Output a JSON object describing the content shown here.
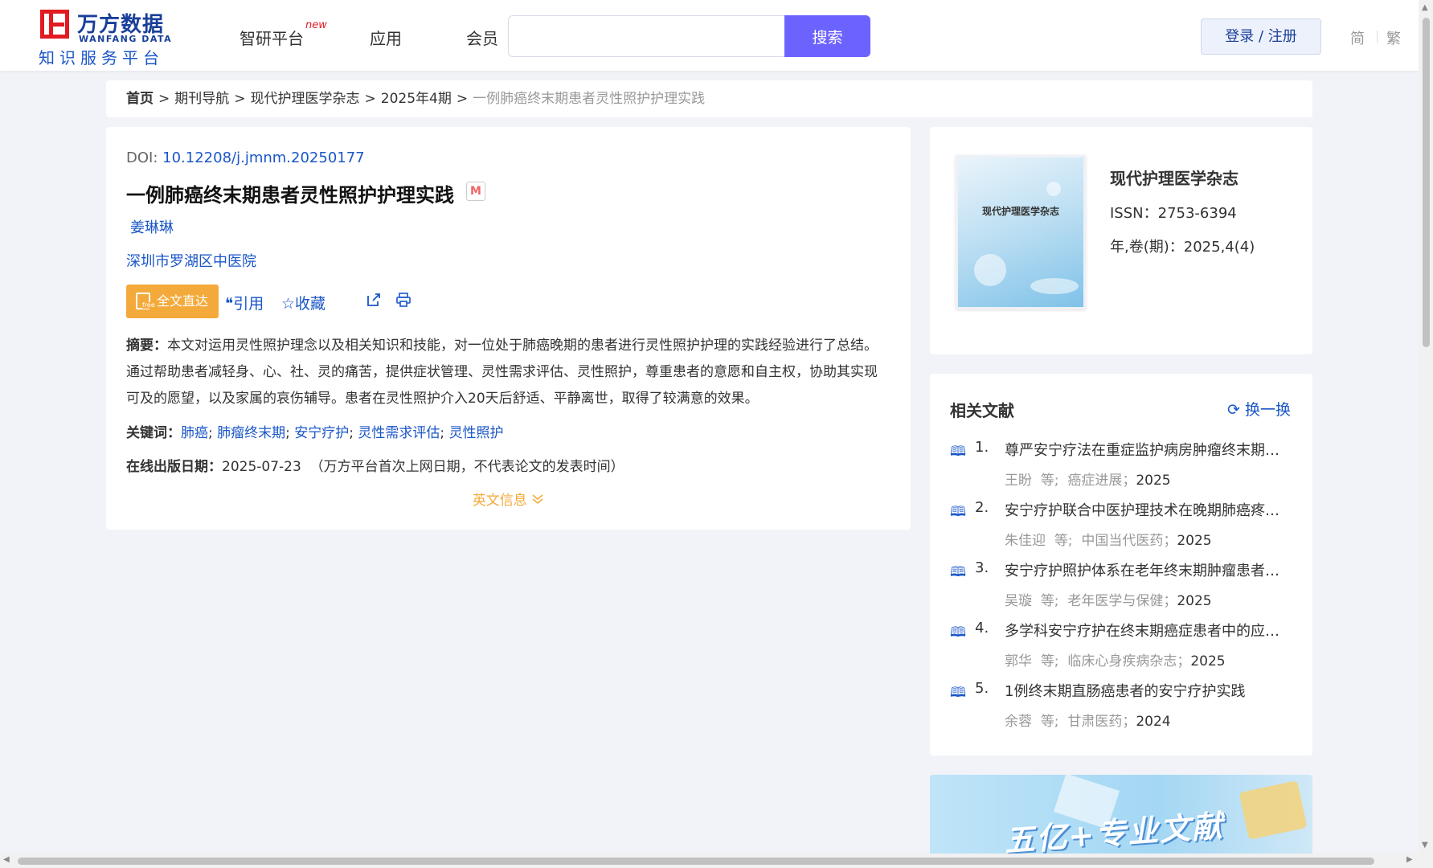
{
  "header": {
    "logo": {
      "cn": "万方数据",
      "en": "WANFANG DATA",
      "sub": "知识服务平台"
    },
    "nav": [
      {
        "label": "智研平台",
        "badge": "new"
      },
      {
        "label": "应用"
      },
      {
        "label": "会员"
      }
    ],
    "search": {
      "value": "",
      "placeholder": "",
      "button": "搜索"
    },
    "login": "登录 / 注册",
    "lang": {
      "simplified": "简",
      "traditional": "繁"
    }
  },
  "breadcrumb": {
    "items": [
      "首页",
      "期刊导航",
      "现代护理医学杂志",
      "2025年4期"
    ],
    "current": "一例肺癌终末期患者灵性照护护理实践",
    "sep": ">"
  },
  "article": {
    "doi_label": "DOI:",
    "doi": "10.12208/j.jmnm.20250177",
    "title": "一例肺癌终末期患者灵性照护护理实践",
    "badge": "M",
    "author": "姜琳琳",
    "org": "深圳市罗湖区中医院",
    "actions": {
      "fulltext": "全文直达",
      "cite": "引用",
      "favorite": "收藏"
    },
    "abstract_label": "摘要：",
    "abstract": "本文对运用灵性照护理念以及相关知识和技能，对一位处于肺癌晚期的患者进行灵性照护护理的实践经验进行了总结。通过帮助患者减轻身、心、社、灵的痛苦，提供症状管理、灵性需求评估、灵性照护，尊重患者的意愿和自主权，协助其实现可及的愿望，以及家属的哀伤辅导。患者在灵性照护介入20天后舒适、平静离世，取得了较满意的效果。",
    "keywords_label": "关键词：",
    "keywords": [
      "肺癌",
      "肺瘤终末期",
      "安宁疗护",
      "灵性需求评估",
      "灵性照护"
    ],
    "pubdate_label": "在线出版日期：",
    "pubdate": "2025-07-23",
    "pubdate_note": "（万方平台首次上网日期，不代表论文的发表时间）",
    "english_info": "英文信息"
  },
  "journal": {
    "cover_title": "现代护理医学杂志",
    "name": "现代护理医学杂志",
    "issn": "ISSN：2753-6394",
    "volume": "年,卷(期)：2025,4(4)"
  },
  "related": {
    "title": "相关文献",
    "refresh": "换一换",
    "items": [
      {
        "num": "1.",
        "title": "尊严安宁疗法在重症监护病房肿瘤终末期患者中的应用",
        "author": "王盼",
        "etal": "等;",
        "journal": "癌症进展",
        "year": "2025"
      },
      {
        "num": "2.",
        "title": "安宁疗护联合中医护理技术在晚期肺癌疼痛患者中的应用",
        "author": "朱佳迎",
        "etal": "等;",
        "journal": "中国当代医药",
        "year": "2025"
      },
      {
        "num": "3.",
        "title": "安宁疗护照护体系在老年终末期肿瘤患者中的应用",
        "author": "吴璇",
        "etal": "等;",
        "journal": "老年医学与保健",
        "year": "2025"
      },
      {
        "num": "4.",
        "title": "多学科安宁疗护在终末期癌症患者中的应用效果",
        "author": "郭华",
        "etal": "等;",
        "journal": "临床心身疾病杂志",
        "year": "2025"
      },
      {
        "num": "5.",
        "title": "1例终末期直肠癌患者的安宁疗护实践",
        "author": "余蓉",
        "etal": "等;",
        "journal": "甘肃医药",
        "year": "2024"
      }
    ]
  },
  "banner": {
    "text": "五亿+专业文献"
  }
}
